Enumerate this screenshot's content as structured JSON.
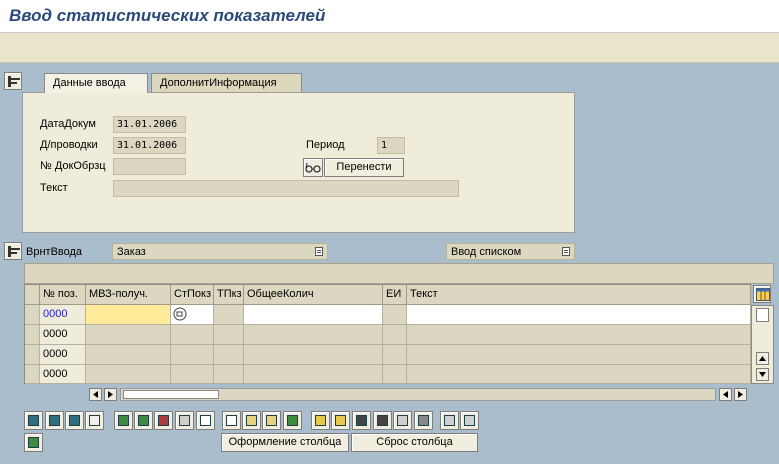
{
  "window": {
    "title": "Ввод статистических показателей"
  },
  "tabs": [
    {
      "label": "Данные ввода",
      "active": true
    },
    {
      "label": "ДополнитИнформация",
      "active": false
    }
  ],
  "header": {
    "doc_date_label": "ДатаДокум",
    "doc_date_value": "31.01.2006",
    "post_date_label": "Д/проводки",
    "post_date_value": "31.01.2006",
    "ref_doc_label": "№ ДокОбрзц",
    "ref_doc_value": "",
    "text_label": "Текст",
    "text_value": "",
    "period_label": "Период",
    "period_value": "1",
    "transfer_button": "Перенести"
  },
  "input_variant": {
    "label": "ВрнтВвода",
    "value": "Заказ",
    "mode_value": "Ввод списком"
  },
  "table": {
    "columns": [
      "№ поз.",
      "МВЗ-получ.",
      "СтПокз",
      "ТПкз",
      "ОбщееКолич",
      "ЕИ",
      "Текст"
    ],
    "rows": [
      {
        "pos": "0000"
      },
      {
        "pos": "0000"
      },
      {
        "pos": "0000"
      },
      {
        "pos": "0000"
      }
    ]
  },
  "buttons": {
    "column_format": "Оформление столбца",
    "column_reset": "Сброс столбца"
  },
  "colors": {
    "accent": "#2b4a7c",
    "selected_pos": "#1a1ad0",
    "highlight": "#ffeb99"
  }
}
